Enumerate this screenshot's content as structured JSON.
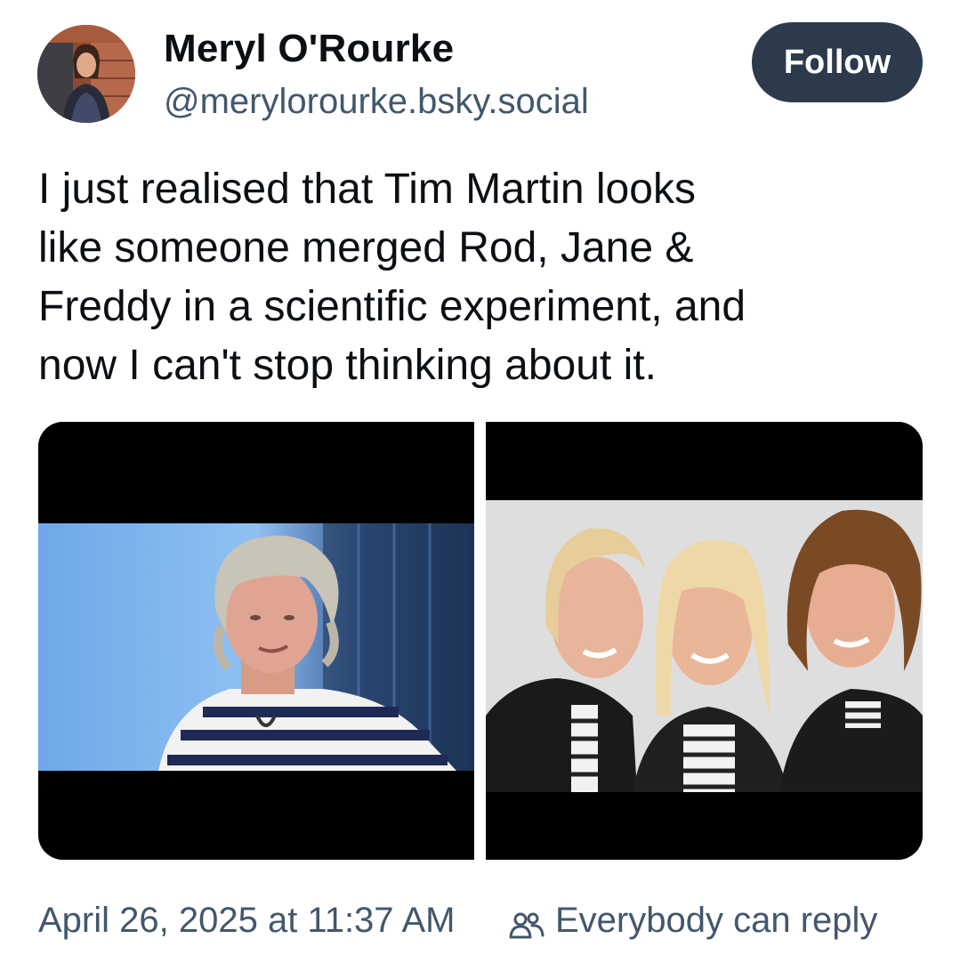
{
  "author": {
    "display_name": "Meryl O'Rourke",
    "handle": "@merylorourke.bsky.social"
  },
  "follow_button": {
    "label": "Follow"
  },
  "post": {
    "text_lines": [
      "I just realised that Tim Martin looks",
      "like someone merged Rod, Jane &",
      "Freddy in a scientific experiment, and",
      "now I can't stop thinking about it."
    ],
    "date": "April 26, 2025 at 11:37 AM",
    "reply_setting": "Everybody can reply"
  },
  "icons": {
    "reply_setting_icon": "people-icon"
  },
  "colors": {
    "follow_button_bg": "#2c3a4b",
    "muted_text": "#42576c"
  }
}
